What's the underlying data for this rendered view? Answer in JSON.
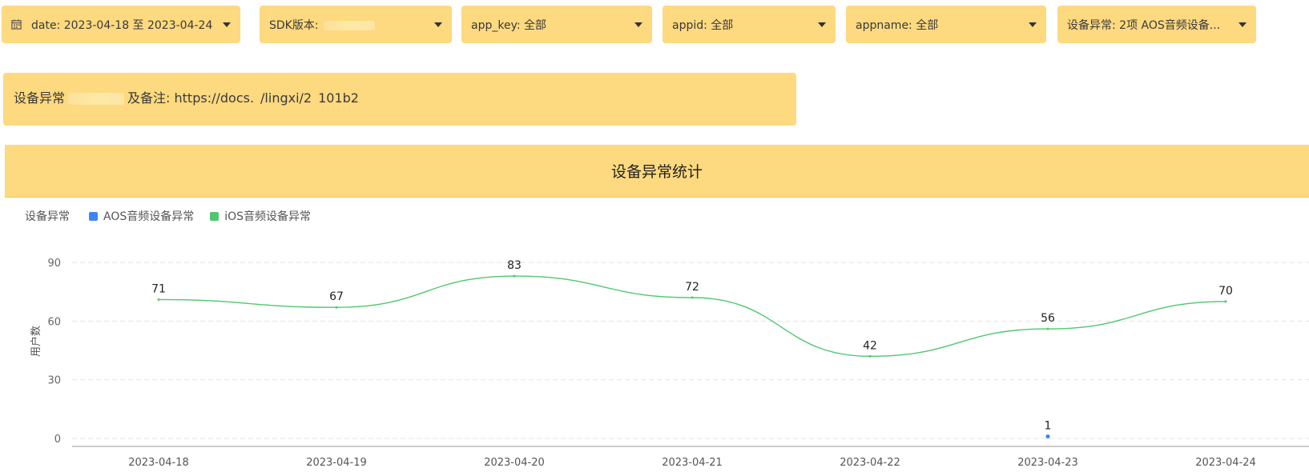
{
  "filters": {
    "date": {
      "label": "date: 2023-04-18 至 2023-04-24"
    },
    "sdk": {
      "label": "SDK版本:"
    },
    "app_key": {
      "label": "app_key: 全部"
    },
    "appid": {
      "label": "appid: 全部"
    },
    "appname": {
      "label": "appname: 全部"
    },
    "device": {
      "label": "设备异常: 2项 AOS音频设备..."
    }
  },
  "notice": {
    "prefix": "设备异常",
    "mid": "及备注:",
    "link": "https://docs.",
    "link_mid": "/lingxi/2",
    "link_end": "101b2"
  },
  "panel": {
    "title": "设备异常统计"
  },
  "legend": {
    "title": "设备异常",
    "items": [
      {
        "name": "AOS音频设备异常",
        "color": "#3f85f5"
      },
      {
        "name": "iOS音频设备异常",
        "color": "#4ec86e"
      }
    ]
  },
  "chart_data": {
    "type": "line",
    "title": "设备异常统计",
    "xlabel": "",
    "ylabel": "用户数",
    "categories": [
      "2023-04-18",
      "2023-04-19",
      "2023-04-20",
      "2023-04-21",
      "2023-04-22",
      "2023-04-23",
      "2023-04-24"
    ],
    "ylim": [
      0,
      90
    ],
    "yticks": [
      0,
      30,
      60,
      90
    ],
    "grid": true,
    "legend_placement": "top-left",
    "series": [
      {
        "name": "AOS音频设备异常",
        "color": "#3f85f5",
        "values": [
          null,
          null,
          null,
          null,
          null,
          1,
          null
        ]
      },
      {
        "name": "iOS音频设备异常",
        "color": "#4ec86e",
        "values": [
          71,
          67,
          83,
          72,
          42,
          56,
          70
        ]
      }
    ]
  }
}
